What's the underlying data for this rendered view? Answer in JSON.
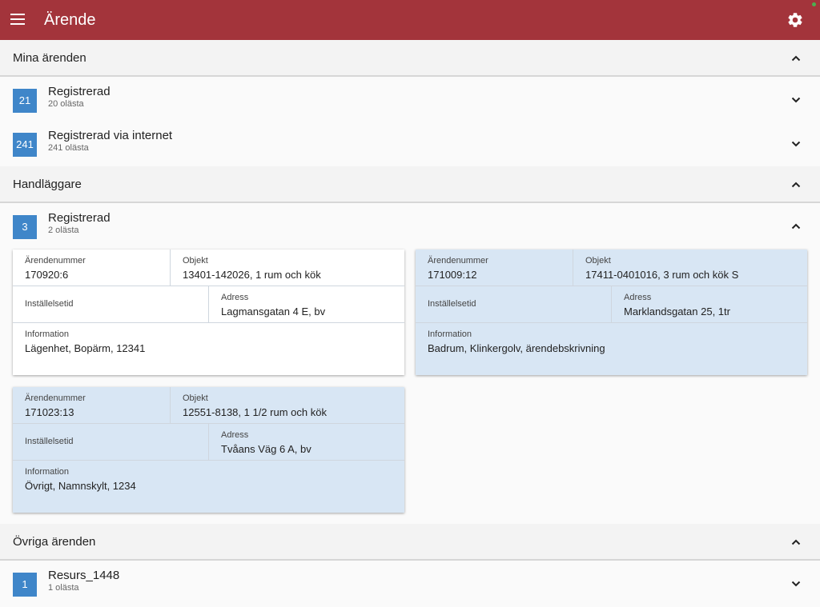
{
  "app": {
    "title": "Ärende",
    "menu_icon": "menu-icon",
    "settings_icon": "gear-icon",
    "accent": "#a3343b",
    "badge_color": "#3f86c9",
    "card_tint": "#d8e6f4"
  },
  "sections": [
    {
      "title": "Mina ärenden",
      "groups": [
        {
          "count": "21",
          "title": "Registrerad",
          "subtitle": "20 olästa"
        },
        {
          "count": "241",
          "title": "Registrerad via internet",
          "subtitle": "241 olästa"
        }
      ]
    },
    {
      "title": "Handläggare",
      "groups": [
        {
          "count": "3",
          "title": "Registrerad",
          "subtitle": "2 olästa",
          "cards": [
            {
              "arendenummer": "170920:6",
              "objekt": "13401-142026, 1 rum och kök",
              "installelsetid": "",
              "adress": "Lagmansgatan 4 E, bv",
              "information": "Lägenhet, Bopärm, 12341"
            },
            {
              "arendenummer": "171009:12",
              "objekt": "17411-0401016, 3 rum och kök S",
              "installelsetid": "",
              "adress": "Marklandsgatan 25, 1tr",
              "information": "Badrum, Klinkergolv, ärendebskrivning"
            },
            {
              "arendenummer": "171023:13",
              "objekt": "12551-8138, 1 1/2 rum och kök",
              "installelsetid": "",
              "adress": "Tvåans Väg 6 A, bv",
              "information": "Övrigt, Namnskylt, 1234"
            }
          ]
        }
      ]
    },
    {
      "title": "Övriga ärenden",
      "groups": [
        {
          "count": "1",
          "title": "Resurs_1448",
          "subtitle": "1 olästa"
        }
      ]
    }
  ],
  "card_labels": {
    "arendenummer": "Ärendenummer",
    "objekt": "Objekt",
    "installelsetid": "Inställelsetid",
    "adress": "Adress",
    "information": "Information"
  }
}
